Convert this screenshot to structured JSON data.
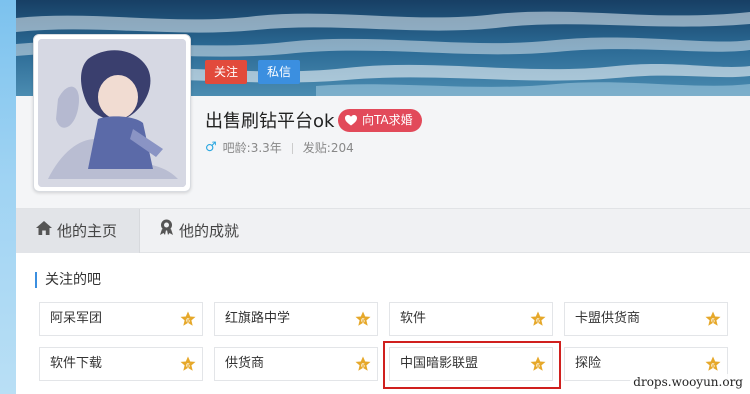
{
  "profile": {
    "follow_label": "关注",
    "message_label": "私信",
    "username": "出售刷钻平台ok",
    "propose_label": "向TA求婚",
    "gender_icon": "male-icon",
    "age_label": "吧龄:3.3年",
    "posts_label": "发贴:204"
  },
  "tabs": [
    {
      "label": "他的主页",
      "icon": "home-icon",
      "active": true
    },
    {
      "label": "他的成就",
      "icon": "medal-icon",
      "active": false
    }
  ],
  "section_title": "关注的吧",
  "bars": [
    {
      "name": "阿呆军团"
    },
    {
      "name": "红旗路中学"
    },
    {
      "name": "软件"
    },
    {
      "name": "卡盟供货商"
    },
    {
      "name": "软件下载"
    },
    {
      "name": "供货商"
    },
    {
      "name": "中国暗影联盟",
      "highlighted": true
    },
    {
      "name": "探险"
    }
  ],
  "watermark": "drops.wooyun.org",
  "colors": {
    "follow": "#e24a3b",
    "message": "#3b8fe0",
    "propose": "#e24a5a",
    "highlight": "#d0201e",
    "star": "#e6a82a"
  }
}
